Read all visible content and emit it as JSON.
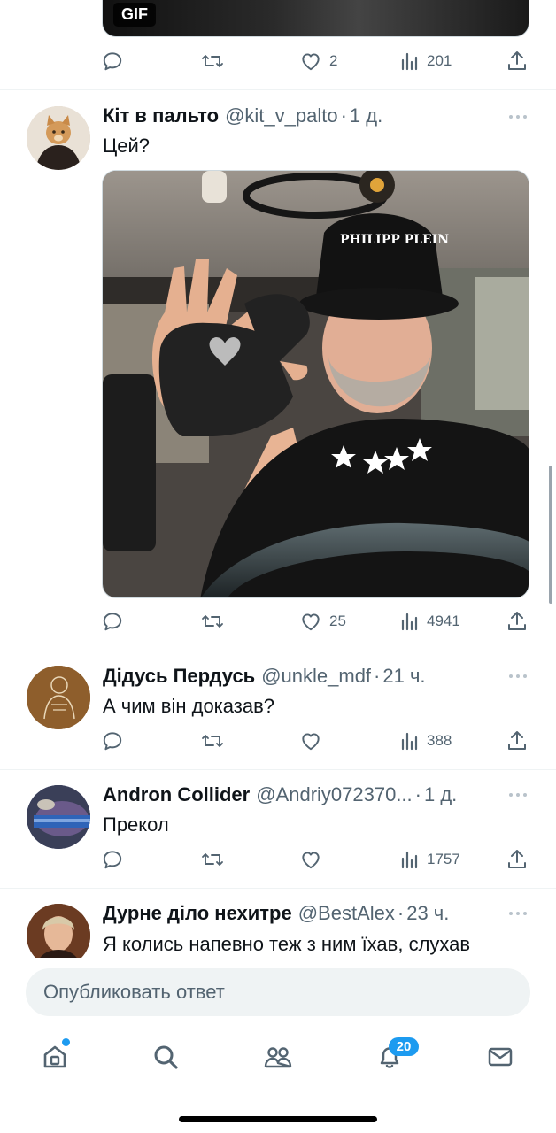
{
  "previous_tweet": {
    "media_badge": "GIF",
    "actions": {
      "reply": "",
      "retweet": "",
      "like": "2",
      "views": "201"
    }
  },
  "tweets": [
    {
      "name": "Кіт в пальто",
      "handle": "@kit_v_palto",
      "time": "1 д.",
      "text": "Цей?",
      "image_text": "PHILIPP PLEIN",
      "actions": {
        "reply": "",
        "retweet": "",
        "like": "25",
        "views": "4941"
      }
    },
    {
      "name": "Дідусь Пердусь",
      "handle": "@unkle_mdf",
      "time": "21 ч.",
      "text": "А чим він доказав?",
      "actions": {
        "reply": "",
        "retweet": "",
        "like": "",
        "views": "388"
      }
    },
    {
      "name": "Andron Collider",
      "handle": "@Andriy072370...",
      "time": "1 д.",
      "text": "Прекол",
      "actions": {
        "reply": "",
        "retweet": "",
        "like": "",
        "views": "1757"
      }
    },
    {
      "name": "Дурне діло нехитре",
      "handle": "@BestAlex",
      "time": "23 ч.",
      "text": "Я колись напевно теж з ним їхав, слухав",
      "actions": {
        "reply": "",
        "retweet": "",
        "like": "",
        "views": ""
      }
    }
  ],
  "reply_box": {
    "placeholder": "Опубликовать ответ"
  },
  "tabbar": {
    "items": [
      "home-icon",
      "search-icon",
      "communities-icon",
      "notifications-icon",
      "messages-icon"
    ],
    "notifications_count": "20"
  },
  "colors": {
    "accent": "#1d9bf0",
    "text": "#0f1419",
    "secondary": "#536471",
    "divider": "#eff3f4"
  }
}
